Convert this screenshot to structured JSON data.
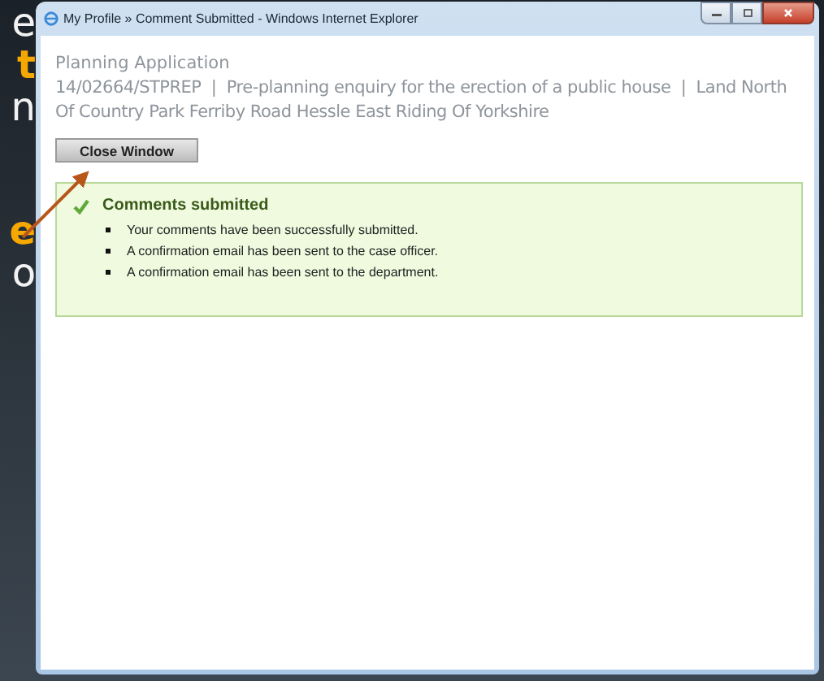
{
  "side_text": {
    "paragraphs": [
      [
        {
          "text": "e",
          "highlighted": false
        },
        {
          "text": "t",
          "highlighted": true
        },
        {
          "text": "n",
          "highlighted": false
        }
      ],
      [
        {
          "text": "e",
          "highlighted": true
        },
        {
          "text": "o",
          "highlighted": false
        }
      ]
    ]
  },
  "window": {
    "title": "My Profile » Comment Submitted - Windows Internet Explorer"
  },
  "page": {
    "heading": "Planning Application",
    "description": "14/02664/STPREP  |  Pre-planning enquiry for the erection of a public house  |  Land North Of Country Park Ferriby Road Hessle East Riding Of Yorkshire",
    "close_button": "Close Window"
  },
  "message": {
    "kind": "success",
    "title": "Comments submitted",
    "items": [
      "Your comments have been successfully submitted.",
      "A confirmation email has been sent to the case officer.",
      "A confirmation email has been sent to the department."
    ]
  }
}
